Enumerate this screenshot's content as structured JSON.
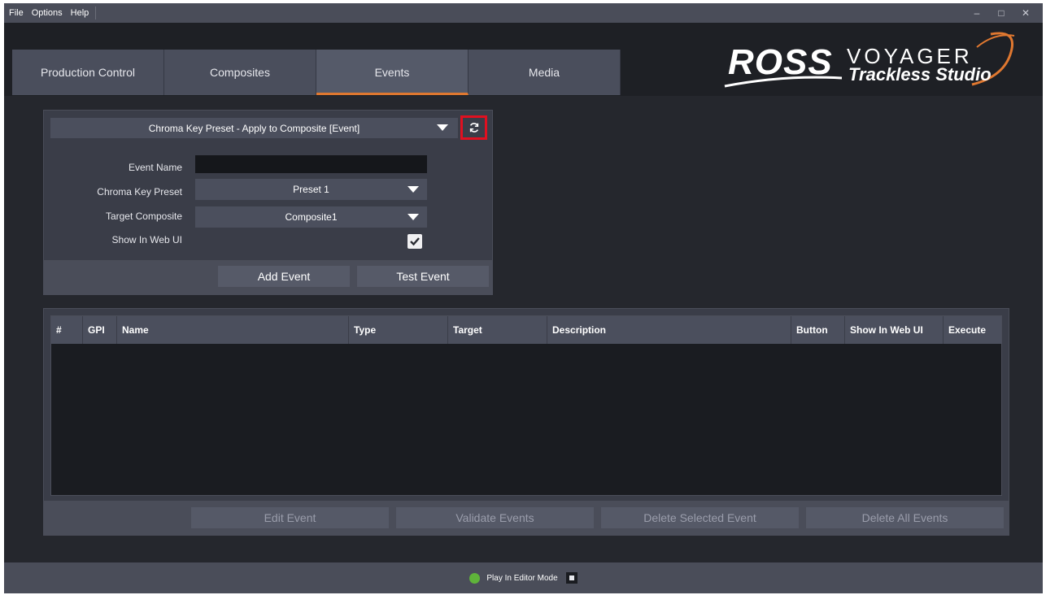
{
  "menu": {
    "items": [
      "File",
      "Options",
      "Help"
    ]
  },
  "window_controls": {
    "minimize": "–",
    "maximize": "□",
    "close": "✕"
  },
  "tabs": [
    {
      "label": "Production Control",
      "active": false
    },
    {
      "label": "Composites",
      "active": false
    },
    {
      "label": "Events",
      "active": true
    },
    {
      "label": "Media",
      "active": false
    }
  ],
  "logo": {
    "brand": "ROSS",
    "product": "VOYAGER",
    "subtitle": "Trackless Studio"
  },
  "editor": {
    "event_type": "Chroma Key Preset - Apply to Composite [Event]",
    "fields": {
      "event_name_label": "Event Name",
      "event_name_value": "",
      "chroma_key_preset_label": "Chroma Key Preset",
      "chroma_key_preset_value": "Preset 1",
      "target_composite_label": "Target Composite",
      "target_composite_value": "Composite1",
      "show_in_web_ui_label": "Show In Web UI",
      "show_in_web_ui_checked": true
    },
    "add_label": "Add Event",
    "test_label": "Test Event"
  },
  "table": {
    "columns": [
      "#",
      "GPI",
      "Name",
      "Type",
      "Target",
      "Description",
      "Button",
      "Show In Web UI",
      "Execute"
    ],
    "rows": []
  },
  "table_actions": {
    "edit": "Edit Event",
    "validate": "Validate Events",
    "delete_selected": "Delete Selected Event",
    "delete_all": "Delete All Events"
  },
  "status": {
    "text": "Play In Editor Mode",
    "indicator_color": "#5fb33a"
  },
  "colors": {
    "accent": "#e07830",
    "highlight": "#e01020"
  }
}
